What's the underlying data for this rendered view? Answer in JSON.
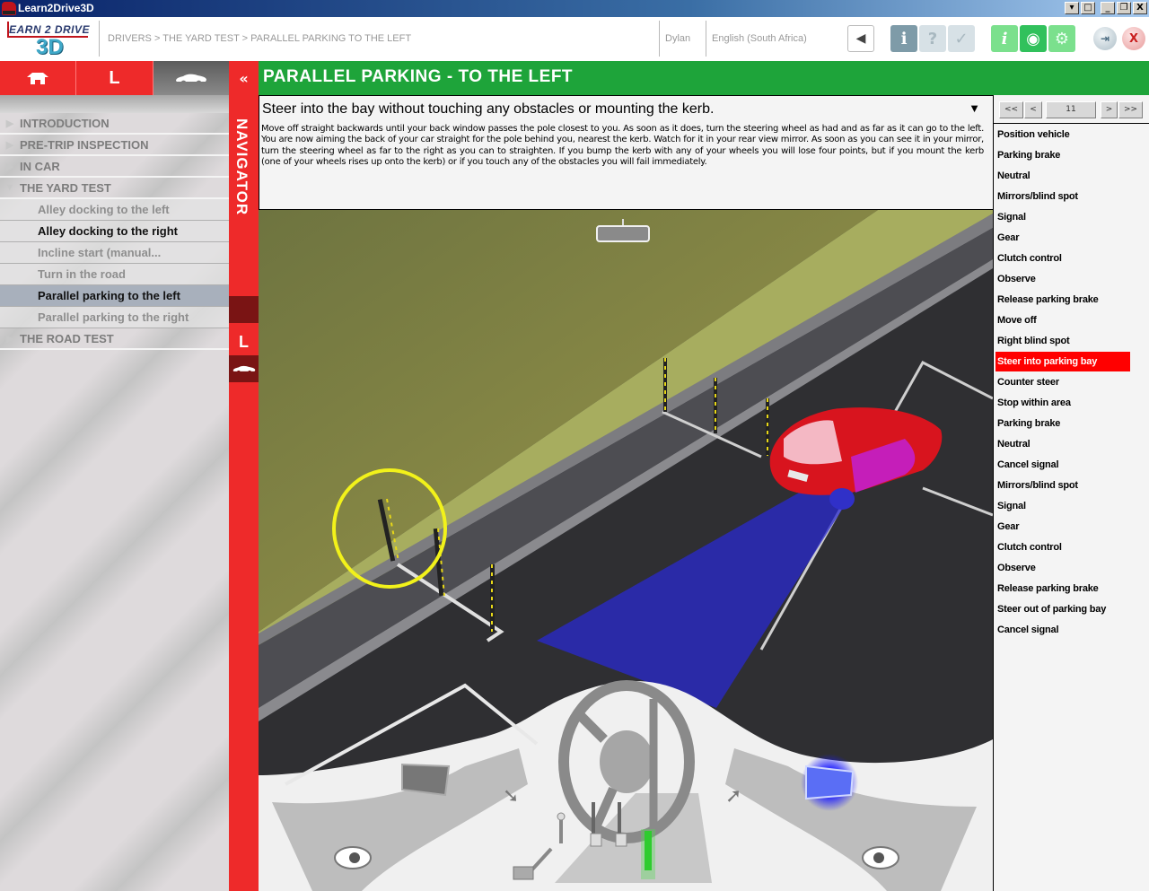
{
  "window": {
    "title": "Learn2Drive3D",
    "controls": [
      "menu",
      "restore-small",
      "minimize",
      "restore",
      "close"
    ]
  },
  "header": {
    "logo_top": "EARN 2 DRIVE",
    "logo_bottom": "3D",
    "breadcrumb": "DRIVERS > THE YARD TEST > PARALLEL PARKING TO THE LEFT",
    "user": "Dylan",
    "language": "English (South Africa)",
    "buttons": {
      "back": "◀",
      "guide": "ℹ",
      "help": "?",
      "check": "✓",
      "info": "i",
      "film": "◉",
      "settings": "⚙",
      "exit": "⇥",
      "close": "X"
    }
  },
  "sidebar": {
    "tabs": [
      {
        "icon": "house-icon",
        "glyph": "⌂"
      },
      {
        "icon": "learner-icon",
        "glyph": "L"
      },
      {
        "icon": "car-icon",
        "glyph": "▬"
      }
    ],
    "sections": [
      {
        "label": "INTRODUCTION",
        "expanded": false
      },
      {
        "label": "PRE-TRIP INSPECTION",
        "expanded": false
      },
      {
        "label": "IN CAR",
        "expanded": false
      },
      {
        "label": "THE YARD TEST",
        "expanded": true,
        "children": [
          {
            "label": "Alley docking to the left",
            "state": "inactive"
          },
          {
            "label": "Alley docking to the right",
            "state": "available"
          },
          {
            "label": "Incline  start  (manual...",
            "state": "inactive"
          },
          {
            "label": "Turn in the road",
            "state": "inactive"
          },
          {
            "label": "Parallel parking to the left",
            "state": "selected"
          },
          {
            "label": "Parallel parking to the right",
            "state": "inactive"
          }
        ]
      },
      {
        "label": "THE ROAD TEST",
        "expanded": false
      }
    ]
  },
  "navigator": {
    "collapse": "«",
    "label": "NAVIGATOR",
    "mini": [
      "⌂",
      "L",
      "▬"
    ]
  },
  "page": {
    "title": "PARALLEL PARKING - TO THE LEFT"
  },
  "instruction": {
    "heading": "Steer into the bay without touching any obstacles or mounting the kerb.",
    "expand": "▼",
    "body": "Move off straight backwards until your back window passes the pole closest to you. As soon as it does, turn the steering wheel as had and as far as it can go to the left. You are now aiming the back of your car straight for the pole behind you, nearest the kerb. Watch for it in your rear view mirror. As soon as you can see it in your mirror, turn the steering wheel as far to the right as you can to straighten. If you bump the kerb with any of your wheels you will lose four points, but if you mount the kerb (one of your wheels rises up onto the kerb) or if you touch any of the obstacles you will fail immediately."
  },
  "scene": {
    "highlight_color": "#ffff00",
    "path_color": "#2020ff",
    "car_color": "#d8141e",
    "controls": {
      "left_indicator": "off",
      "right_indicator": "on",
      "active_pedal": "accelerator"
    }
  },
  "steps": {
    "pager": {
      "first": "<<",
      "prev": "<",
      "current": "11",
      "next": ">",
      "last": ">>"
    },
    "current_index": 11,
    "items": [
      "Position vehicle",
      "Parking brake",
      "Neutral",
      "Mirrors/blind spot",
      "Signal",
      "Gear",
      "Clutch control",
      "Observe",
      "Release parking brake",
      "Move off",
      "Right blind spot",
      "Steer into parking bay",
      "Counter steer",
      "Stop within area",
      "Parking brake",
      "Neutral",
      "Cancel signal",
      "Mirrors/blind spot",
      "Signal",
      "Gear",
      "Clutch control",
      "Observe",
      "Release parking brake",
      "Steer out of parking bay",
      "Cancel signal"
    ]
  }
}
